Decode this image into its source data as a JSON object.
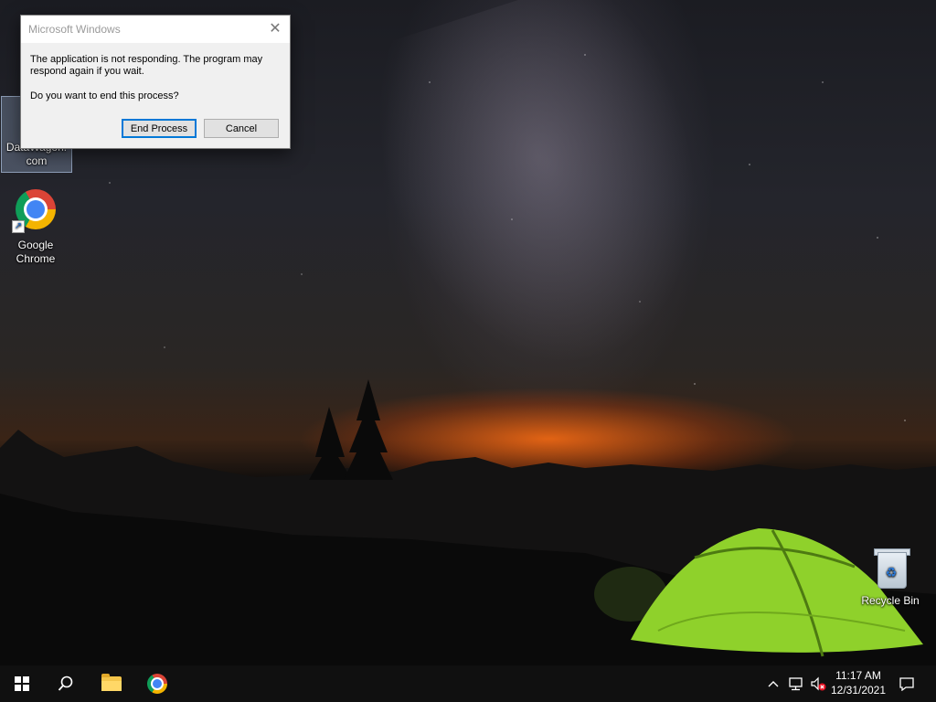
{
  "desktop": {
    "icons": [
      {
        "label": "DataWagon.com",
        "icon": "datawagon-shortcut-icon"
      },
      {
        "label": "Google Chrome",
        "icon": "chrome-icon"
      },
      {
        "label": "Recycle Bin",
        "icon": "recycle-bin-icon"
      }
    ]
  },
  "dialog": {
    "title": "Microsoft Windows",
    "message": "The application is not responding. The program may respond again if you wait.",
    "question": "Do you want to end this process?",
    "end_process_label": "End Process",
    "cancel_label": "Cancel",
    "close_glyph": "✕"
  },
  "taskbar": {
    "start": "windows-logo-icon",
    "search": "search-icon",
    "pinned": [
      "file-explorer-icon",
      "chrome-icon"
    ],
    "tray": {
      "chevron": "^",
      "icons": [
        "network-icon",
        "volume-muted-icon"
      ],
      "time": "11:17 AM",
      "date": "12/31/2021",
      "notification": "action-center-icon"
    }
  },
  "colors": {
    "accent": "#0078d7",
    "taskbar": "#101010",
    "tent": "#8fd12b",
    "horizon_glow": "#ff6a14"
  }
}
